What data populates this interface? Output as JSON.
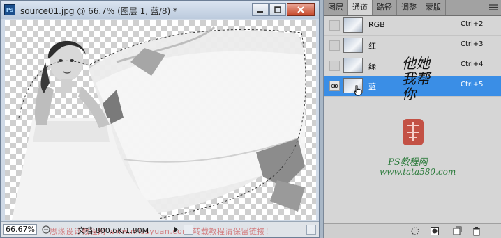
{
  "document": {
    "title": "source01.jpg @ 66.7% (图层 1, 蓝/8) *",
    "app_icon_text": "Ps",
    "zoom": "66.67%",
    "doc_info": "文档:800.6K/1.80M",
    "watermark": "思缘设计教程网 www.missyuan.com  转载教程请保留链接！"
  },
  "panel": {
    "tabs": [
      "图层",
      "通道",
      "路径",
      "调整",
      "蒙版"
    ],
    "active_tab": "通道",
    "channels": [
      {
        "name": "RGB",
        "shortcut": "Ctrl+2",
        "visible": false,
        "selected": false
      },
      {
        "name": "红",
        "shortcut": "Ctrl+3",
        "visible": false,
        "selected": false
      },
      {
        "name": "绿",
        "shortcut": "Ctrl+4",
        "visible": false,
        "selected": false
      },
      {
        "name": "蓝",
        "shortcut": "Ctrl+5",
        "visible": true,
        "selected": true
      }
    ],
    "calligraphy": "他她我帮你",
    "site_name": "PS教程网",
    "site_url": "www.tata580.com"
  },
  "colors": {
    "selected_row": "#3a8ee6",
    "seal_red": "#c0392b",
    "site_text": "#2a7a3a"
  }
}
